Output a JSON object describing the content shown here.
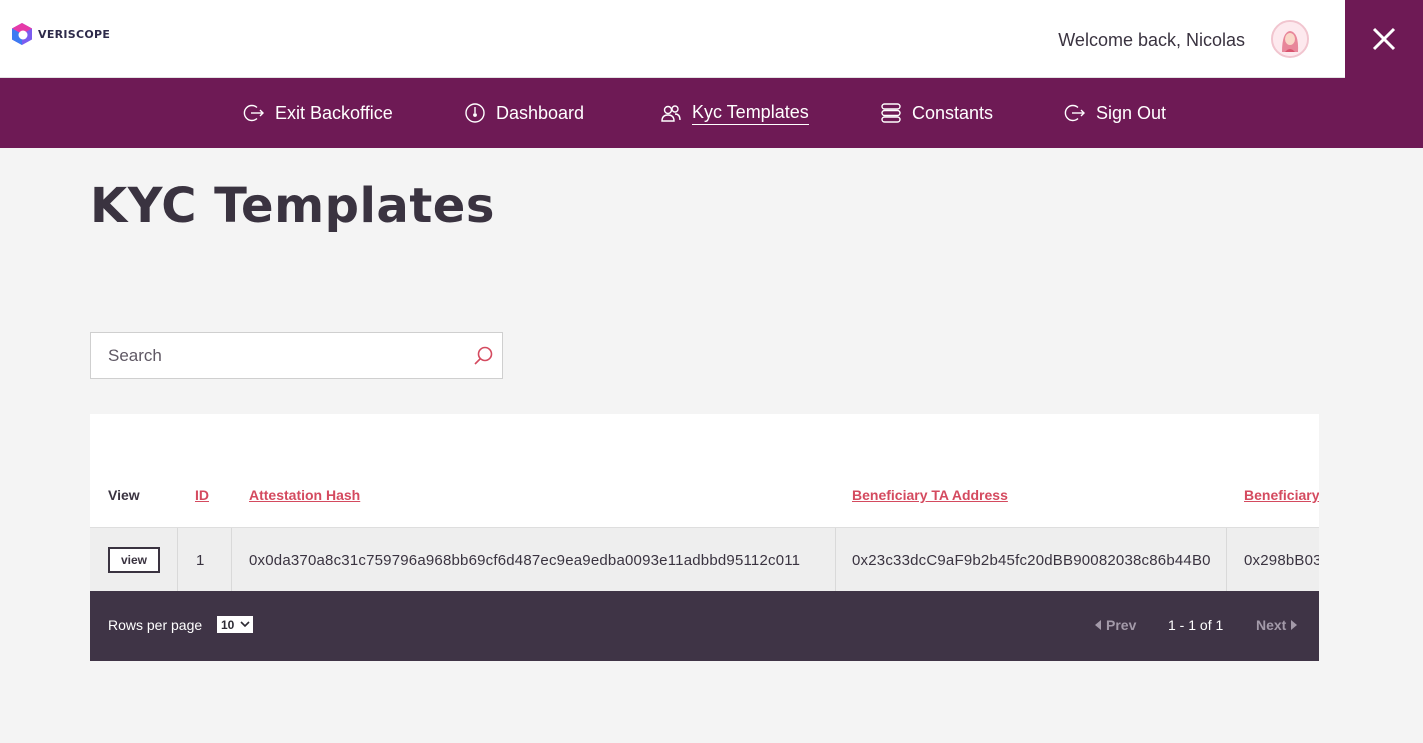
{
  "app": {
    "brand": "VERISCOPE",
    "welcome": "Welcome back, Nicolas",
    "accent": "#6e1a55",
    "link_color": "#d44a5f",
    "footer_bg": "#3f3446"
  },
  "nav": {
    "items": [
      {
        "label": "Exit Backoffice",
        "icon": "exit-icon"
      },
      {
        "label": "Dashboard",
        "icon": "dashboard-icon"
      },
      {
        "label": "Kyc Templates",
        "icon": "users-icon",
        "active": true
      },
      {
        "label": "Constants",
        "icon": "database-icon"
      },
      {
        "label": "Sign Out",
        "icon": "sign-out-icon"
      }
    ]
  },
  "page": {
    "title": "KYC Templates"
  },
  "search": {
    "placeholder": "Search"
  },
  "table": {
    "columns": [
      "View",
      "ID",
      "Attestation Hash",
      "Beneficiary TA Address",
      "Beneficiary"
    ],
    "rows": [
      {
        "view": "view",
        "id": "1",
        "attestation_hash": "0x0da370a8c31c759796a968bb69cf6d487ec9ea9edba0093e11adbbd95112c011",
        "beneficiary_ta_address": "0x23c33dcC9aF9b2b45fc20dBB90082038c86b44B0",
        "beneficiary": "0x298bB03"
      }
    ]
  },
  "pagination": {
    "rows_per_page_label": "Rows per page",
    "rows_per_page_value": "10",
    "prev": "Prev",
    "info": "1 - 1 of 1",
    "next": "Next"
  }
}
